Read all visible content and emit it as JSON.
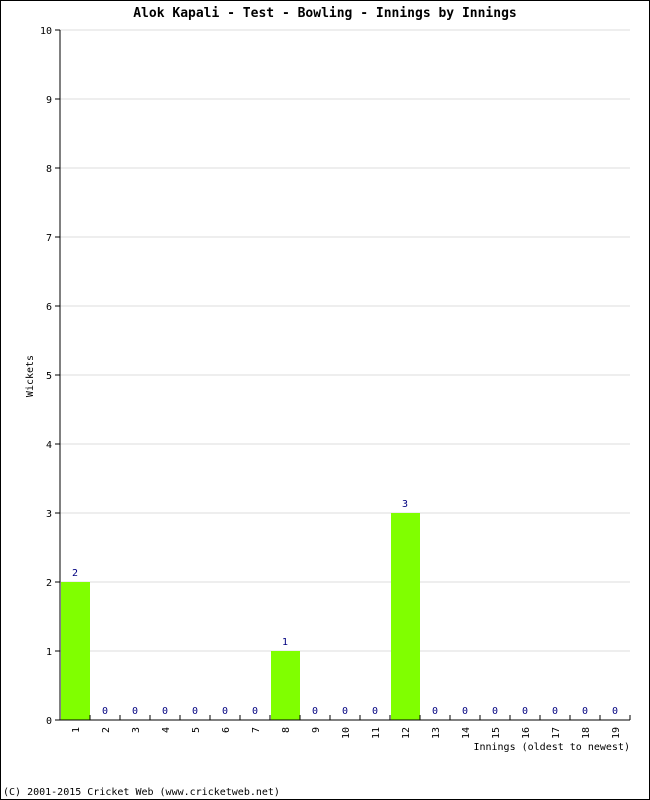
{
  "chart_data": {
    "type": "bar",
    "title": "Alok Kapali - Test - Bowling - Innings by Innings",
    "xlabel": "Innings (oldest to newest)",
    "ylabel": "Wickets",
    "ylim": [
      0,
      10
    ],
    "yticks": [
      "0",
      "1",
      "2",
      "3",
      "4",
      "5",
      "6",
      "7",
      "8",
      "9",
      "10"
    ],
    "categories": [
      "1",
      "2",
      "3",
      "4",
      "5",
      "6",
      "7",
      "8",
      "9",
      "10",
      "11",
      "12",
      "13",
      "14",
      "15",
      "16",
      "17",
      "18",
      "19"
    ],
    "values": [
      2,
      0,
      0,
      0,
      0,
      0,
      0,
      1,
      0,
      0,
      0,
      3,
      0,
      0,
      0,
      0,
      0,
      0,
      0
    ],
    "grid": true,
    "legend": "none",
    "colors": {
      "bar": "#80ff00",
      "data_label": "#000080",
      "grid": "#dddddd",
      "axis": "#000000"
    }
  },
  "footer": "(C) 2001-2015 Cricket Web (www.cricketweb.net)"
}
